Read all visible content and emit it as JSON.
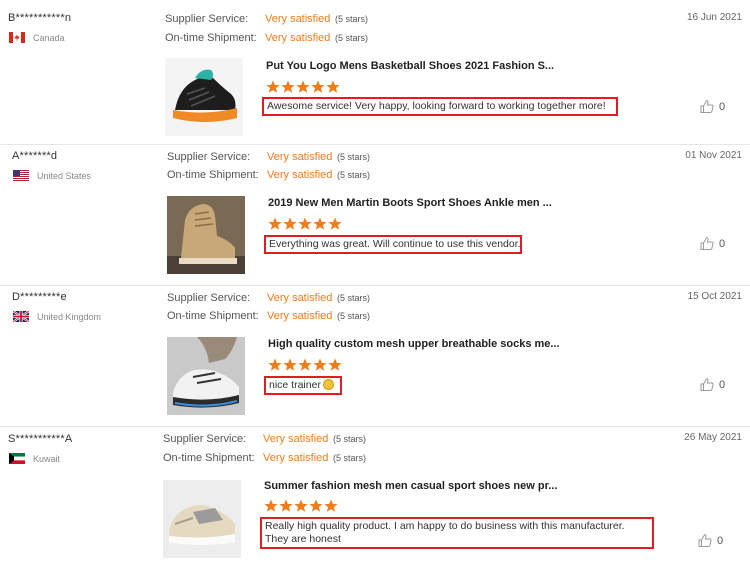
{
  "labels": {
    "supplier_service": "Supplier Service:",
    "ontime_shipment": "On-time Shipment:"
  },
  "colors": {
    "accent": "#f07c1a",
    "highlight_border": "#e11d24",
    "star": "#f07c1a"
  },
  "reviews": [
    {
      "buyer": "B***********n",
      "country": "Canada",
      "flag_icon": "canada-flag-icon",
      "supplier_rating": "Very satisfied",
      "supplier_stars": "(5 stars)",
      "shipment_rating": "Very satisfied",
      "shipment_stars": "(5 stars)",
      "date": "16 Jun 2021",
      "product_title": "Put You Logo Mens Basketball Shoes 2021 Fashion S...",
      "stars": 5,
      "comment": "Awesome service! Very happy, looking forward to  working together more!",
      "likes": "0"
    },
    {
      "buyer": "A*******d",
      "country": "United States",
      "flag_icon": "usa-flag-icon",
      "supplier_rating": "Very satisfied",
      "supplier_stars": "(5 stars)",
      "shipment_rating": "Very satisfied",
      "shipment_stars": "(5 stars)",
      "date": "01 Nov 2021",
      "product_title": "2019 New Men Martin Boots Sport Shoes Ankle men ...",
      "stars": 5,
      "comment": "Everything was great. Will continue to use this vendor.",
      "likes": "0"
    },
    {
      "buyer": "D*********e",
      "country": "United Kingdom",
      "flag_icon": "uk-flag-icon",
      "supplier_rating": "Very satisfied",
      "supplier_stars": "(5 stars)",
      "shipment_rating": "Very satisfied",
      "shipment_stars": "(5 stars)",
      "date": "15 Oct 2021",
      "product_title": "High quality custom mesh upper breathable socks me...",
      "stars": 5,
      "comment": "nice trainer",
      "likes": "0"
    },
    {
      "buyer": "S***********A",
      "country": "Kuwait",
      "flag_icon": "kuwait-flag-icon",
      "supplier_rating": "Very satisfied",
      "supplier_stars": "(5 stars)",
      "shipment_rating": "Very satisfied",
      "shipment_stars": "(5 stars)",
      "date": "26 May 2021",
      "product_title": "Summer fashion mesh men casual sport shoes new pr...",
      "stars": 5,
      "comment": "Really high quality product. I am happy to do business with this manufacturer. They are honest",
      "likes": "0"
    }
  ]
}
